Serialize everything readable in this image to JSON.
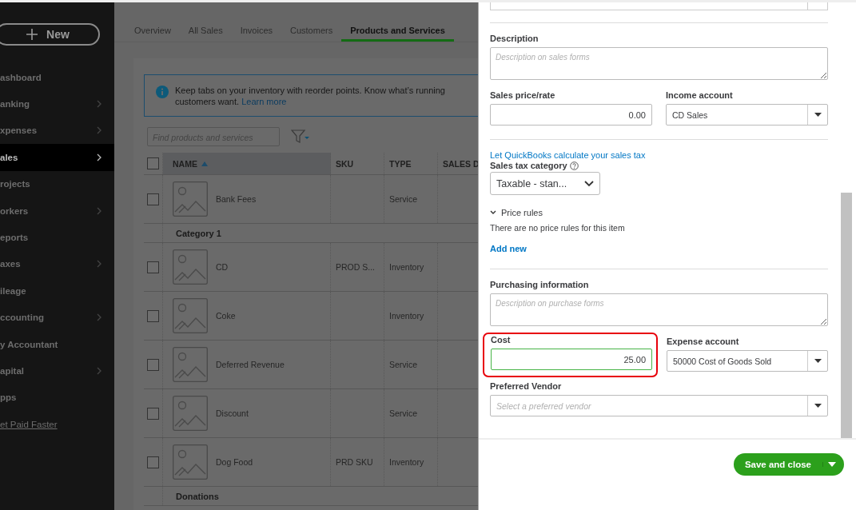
{
  "sidebar": {
    "new_button": {
      "label": "New"
    },
    "items": [
      {
        "label": "ashboard",
        "chevron": false,
        "selected": false,
        "kind": "item"
      },
      {
        "label": "anking",
        "chevron": true,
        "selected": false,
        "kind": "item"
      },
      {
        "label": "xpenses",
        "chevron": true,
        "selected": false,
        "kind": "item"
      },
      {
        "label": "ales",
        "chevron": true,
        "selected": true,
        "kind": "item"
      },
      {
        "label": "rojects",
        "chevron": false,
        "selected": false,
        "kind": "item"
      },
      {
        "label": "orkers",
        "chevron": true,
        "selected": false,
        "kind": "item"
      },
      {
        "label": "eports",
        "chevron": false,
        "selected": false,
        "kind": "item"
      },
      {
        "label": "axes",
        "chevron": true,
        "selected": false,
        "kind": "item"
      },
      {
        "label": "ileage",
        "chevron": false,
        "selected": false,
        "kind": "item"
      },
      {
        "label": "ccounting",
        "chevron": true,
        "selected": false,
        "kind": "item"
      },
      {
        "label": "y Accountant",
        "chevron": false,
        "selected": false,
        "kind": "item"
      },
      {
        "label": "apital",
        "chevron": true,
        "selected": false,
        "kind": "item"
      },
      {
        "label": "pps",
        "chevron": false,
        "selected": false,
        "kind": "item"
      },
      {
        "label": "et Paid Faster",
        "chevron": false,
        "selected": false,
        "kind": "link"
      }
    ]
  },
  "tabs": [
    {
      "label": "Overview",
      "selected": false
    },
    {
      "label": "All Sales",
      "selected": false
    },
    {
      "label": "Invoices",
      "selected": false
    },
    {
      "label": "Customers",
      "selected": false
    },
    {
      "label": "Products and Services",
      "selected": true
    }
  ],
  "banner": {
    "text": "Keep tabs on your inventory with reorder points. Know what’s running",
    "text_2": "customers want.",
    "link": "Learn more"
  },
  "search": {
    "placeholder": "Find products and services"
  },
  "table": {
    "select_all_checked": false,
    "columns": [
      {
        "label": "NAME",
        "sorted": true
      },
      {
        "label": "SKU",
        "sorted": false
      },
      {
        "label": "TYPE",
        "sorted": false
      },
      {
        "label": "SALES D",
        "sorted": false
      }
    ],
    "rows": [
      {
        "kind": "item",
        "name": "Bank Fees",
        "sku": "",
        "type": "Service",
        "checked": false
      },
      {
        "kind": "category",
        "name": "Category 1"
      },
      {
        "kind": "item",
        "name": "CD",
        "sku": "PROD S...",
        "type": "Inventory",
        "checked": false
      },
      {
        "kind": "item",
        "name": "Coke",
        "sku": "",
        "type": "Inventory",
        "checked": false
      },
      {
        "kind": "item",
        "name": "Deferred Revenue",
        "sku": "",
        "type": "Service",
        "checked": false
      },
      {
        "kind": "item",
        "name": "Discount",
        "sku": "",
        "type": "Service",
        "checked": false
      },
      {
        "kind": "item",
        "name": "Dog Food",
        "sku": "PRD SKU",
        "type": "Inventory",
        "checked": false
      },
      {
        "kind": "category",
        "name": "Donations"
      }
    ]
  },
  "panel": {
    "description": {
      "label": "Description",
      "placeholder": "Description on sales forms"
    },
    "sales_price": {
      "label": "Sales price/rate",
      "value": "0.00"
    },
    "income_account": {
      "label": "Income account",
      "value": "CD Sales"
    },
    "tax_link": "Let QuickBooks calculate your sales tax",
    "tax_category": {
      "label": "Sales tax category",
      "value": "Taxable - stan..."
    },
    "price_rules": {
      "label": "Price rules",
      "expanded": true,
      "empty_text": "There are no price rules for this item",
      "add_link": "Add new"
    },
    "purchasing": {
      "label": "Purchasing information",
      "placeholder": "Description on purchase forms"
    },
    "cost": {
      "label": "Cost",
      "value": "25.00",
      "focused": true,
      "highlighted": true
    },
    "expense_account": {
      "label": "Expense account",
      "value": "50000 Cost of Goods Sold"
    },
    "preferred_vendor": {
      "label": "Preferred Vendor",
      "placeholder": "Select a preferred vendor"
    },
    "save_button": {
      "label": "Save and close"
    }
  }
}
